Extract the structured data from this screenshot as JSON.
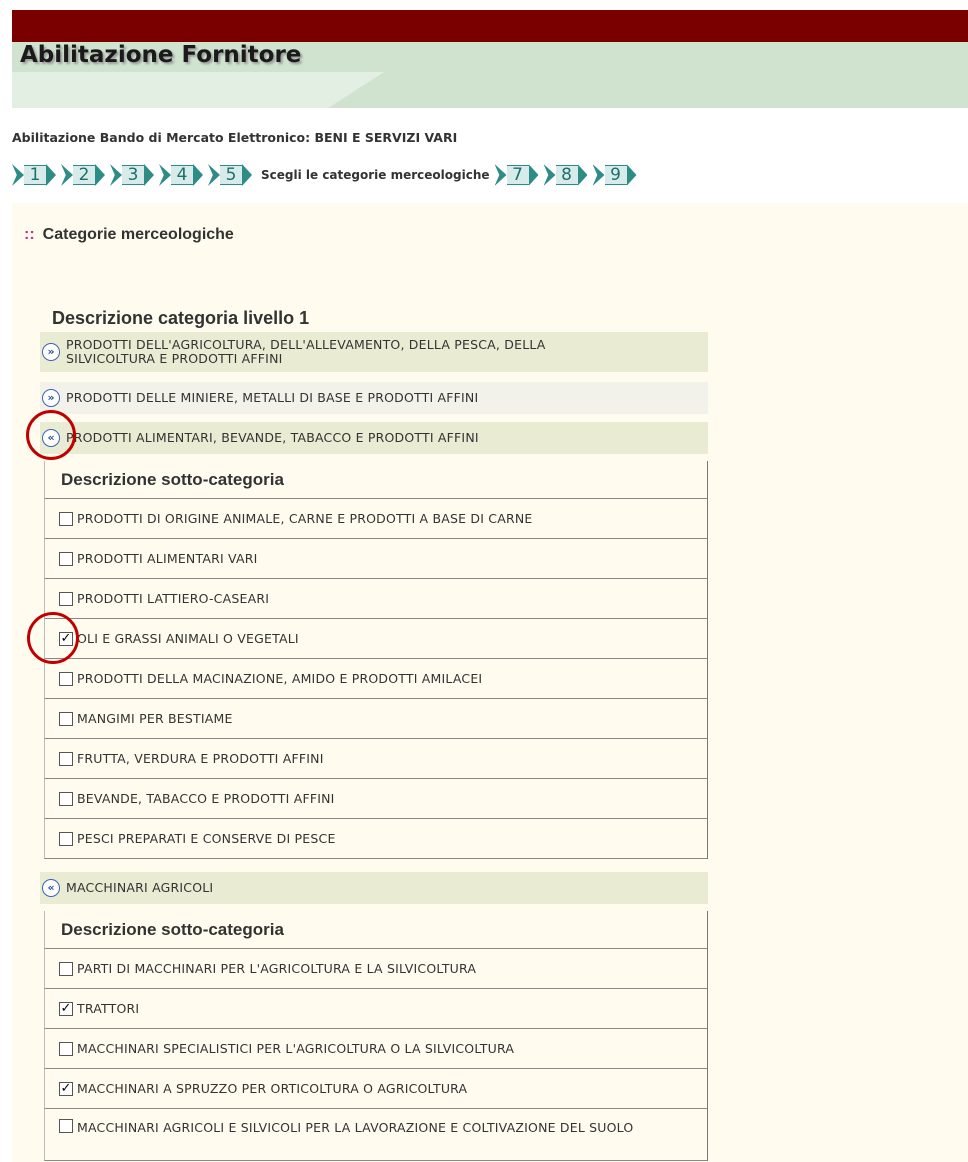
{
  "header": {
    "title": "Abilitazione Fornitore"
  },
  "bando_label": "Abilitazione Bando di Mercato Elettronico: BENI E SERVIZI VARI",
  "steps": {
    "items": [
      "1",
      "2",
      "3",
      "4",
      "5",
      "7",
      "8",
      "9"
    ],
    "current_label": "Scegli le categorie merceologiche"
  },
  "panel": {
    "prefix": "::",
    "title": "Categorie merceologiche",
    "level1_header": "Descrizione categoria livello 1",
    "sub_header": "Descrizione sotto-categoria"
  },
  "categories": [
    {
      "label": "PRODOTTI DELL'AGRICOLTURA, DELL'ALLEVAMENTO, DELLA PESCA, DELLA SILVICOLTURA E PRODOTTI AFFINI",
      "icon": "expand",
      "expanded": false
    },
    {
      "label": "PRODOTTI DELLE MINIERE, METALLI DI BASE E PRODOTTI AFFINI",
      "icon": "expand",
      "expanded": false
    },
    {
      "label": "PRODOTTI ALIMENTARI, BEVANDE, TABACCO E PRODOTTI AFFINI",
      "icon": "collapse",
      "expanded": true,
      "subcategories": [
        {
          "label": "PRODOTTI DI ORIGINE ANIMALE, CARNE E PRODOTTI A BASE DI CARNE",
          "checked": false
        },
        {
          "label": "PRODOTTI ALIMENTARI VARI",
          "checked": false
        },
        {
          "label": "PRODOTTI LATTIERO-CASEARI",
          "checked": false
        },
        {
          "label": "OLI E GRASSI ANIMALI O VEGETALI",
          "checked": true
        },
        {
          "label": "PRODOTTI DELLA MACINAZIONE, AMIDO E PRODOTTI AMILACEI",
          "checked": false
        },
        {
          "label": "MANGIMI PER BESTIAME",
          "checked": false
        },
        {
          "label": "FRUTTA, VERDURA E PRODOTTI AFFINI",
          "checked": false
        },
        {
          "label": "BEVANDE, TABACCO E PRODOTTI AFFINI",
          "checked": false
        },
        {
          "label": "PESCI PREPARATI E CONSERVE DI PESCE",
          "checked": false
        }
      ]
    },
    {
      "label": "MACCHINARI AGRICOLI",
      "icon": "collapse",
      "expanded": true,
      "subcategories": [
        {
          "label": "PARTI DI MACCHINARI PER L'AGRICOLTURA E LA SILVICOLTURA",
          "checked": false
        },
        {
          "label": "TRATTORI",
          "checked": true
        },
        {
          "label": "MACCHINARI SPECIALISTICI PER L'AGRICOLTURA O LA SILVICOLTURA",
          "checked": false
        },
        {
          "label": "MACCHINARI A SPRUZZO PER ORTICOLTURA O AGRICOLTURA",
          "checked": true
        },
        {
          "label": "MACCHINARI AGRICOLI E SILVICOLI PER LA LAVORAZIONE E COLTIVAZIONE DEL SUOLO",
          "checked": false
        }
      ]
    }
  ],
  "icons": {
    "expand": "chevron-double-down-icon",
    "collapse": "chevron-double-up-icon"
  },
  "colors": {
    "topbar": "#7a0000",
    "banner": "#cfe3cf",
    "panel_bg": "#fffbee",
    "step_accent": "#2e8c87",
    "highlight_circle": "#c00000"
  }
}
